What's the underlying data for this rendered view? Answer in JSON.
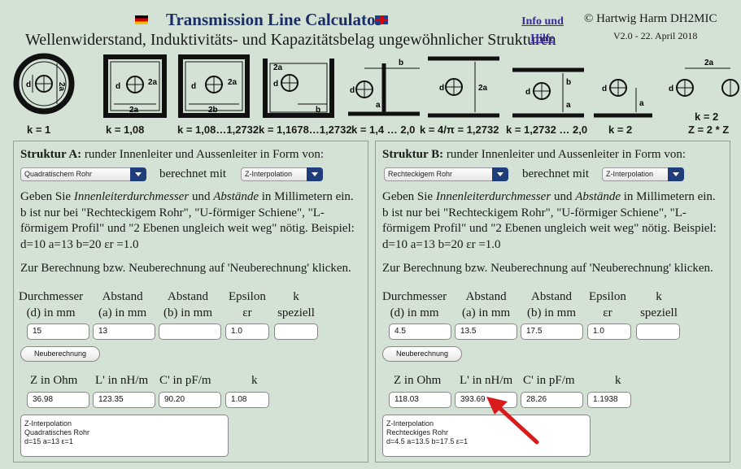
{
  "header": {
    "title": "Transmission Line Calculator",
    "subtitle": "Wellenwiderstand, Induktivitäts- und Kapazitätsbelag ungewöhnlicher Strukturen",
    "info_link_line1": "Info und",
    "info_link_line2": "Hilfe",
    "author": "© Hartwig Harm DH2MIC",
    "version": "V2.0 - 22. April 2018"
  },
  "diagrams": [
    {
      "k": "k = 1",
      "letters": [
        "d",
        "2a"
      ]
    },
    {
      "k": "k = 1,08",
      "letters": [
        "d",
        "2a",
        "2a"
      ]
    },
    {
      "k": "k = 1,08…1,2732",
      "letters": [
        "d",
        "2a",
        "2b"
      ]
    },
    {
      "k": "k = 1,1678…1,2732",
      "letters": [
        "d",
        "2a",
        "b"
      ]
    },
    {
      "k": "k = 1,4 … 2,0",
      "letters": [
        "d",
        "a",
        "b"
      ]
    },
    {
      "k": "k = 4/π = 1,2732",
      "letters": [
        "d",
        "2a"
      ]
    },
    {
      "k": "k = 1,2732 … 2,0",
      "letters": [
        "d",
        "a",
        "b"
      ]
    },
    {
      "k": "k = 2",
      "letters": [
        "d",
        "a"
      ]
    },
    {
      "k": "k = 2",
      "k2": "Z = 2 * Z",
      "letters": [
        "d",
        "2a"
      ]
    }
  ],
  "panelA": {
    "struct_label": "Struktur A:",
    "struct_text": " runder Innenleiter und Aussenleiter in Form von:",
    "shape_select": "Quadratischem Rohr",
    "berechnet_mit": "berechnet mit",
    "method_select": "Z-Interpolation",
    "inputs": {
      "d": "15",
      "a": "13",
      "b": "",
      "eps": "1.0",
      "k": ""
    },
    "results": {
      "Z": "36.98",
      "L": "123.35",
      "C": "90.20",
      "k": "1.08"
    },
    "output_lines": [
      "Z-Interpolation",
      "Quadratisches Rohr",
      "d=15 a=13 ε=1"
    ]
  },
  "panelB": {
    "struct_label": "Struktur B:",
    "struct_text": " runder Innenleiter und Aussenleiter in Form von:",
    "shape_select": "Rechteckigem Rohr",
    "berechnet_mit": "berechnet mit",
    "method_select": "Z-Interpolation",
    "inputs": {
      "d": "4.5",
      "a": "13.5",
      "b": "17.5",
      "eps": "1.0",
      "k": ""
    },
    "results": {
      "Z": "118.03",
      "L": "393.69",
      "C": "28.26",
      "k": "1.1938"
    },
    "output_lines": [
      "Z-Interpolation",
      "Rechteckiges Rohr",
      "d=4.5 a=13.5 b=17.5 ε=1"
    ]
  },
  "common": {
    "desc_1": "Geben Sie ",
    "desc_i1": "Innenleiterdurchmesser",
    "desc_2": " und ",
    "desc_i2": "Abstände",
    "desc_3": " in Millimetern ein.",
    "desc_line2": "b ist nur bei \"Rechteckigem Rohr\", \"U-förmiger Schiene\", \"L-förmigem Profil\" und \"2 Ebenen ungleich weit weg\" nötig. Beispiel:",
    "desc_line3": "d=10   a=13   b=20   εr =1.0",
    "hint": "Zur Berechnung bzw. Neuberechnung auf  'Neuberechnung' klicken.",
    "col_d": [
      "Durchmesser",
      "(d) in mm"
    ],
    "col_a": [
      "Abstand",
      "(a) in mm"
    ],
    "col_b": [
      "Abstand",
      "(b) in mm"
    ],
    "col_eps": [
      "Epsilon",
      "εr"
    ],
    "col_k": [
      "k",
      "speziell"
    ],
    "button": "Neuberechnung",
    "res_Z": "Z in Ohm",
    "res_L": "L' in nH/m",
    "res_C": "C' in pF/m",
    "res_k": "k"
  },
  "colors": {
    "background": "#d3e2d5",
    "title": "#1b2d66",
    "link": "#3b2a9e",
    "select_arrow": "#1f3d7a",
    "annotation_arrow": "#d81c1c"
  }
}
